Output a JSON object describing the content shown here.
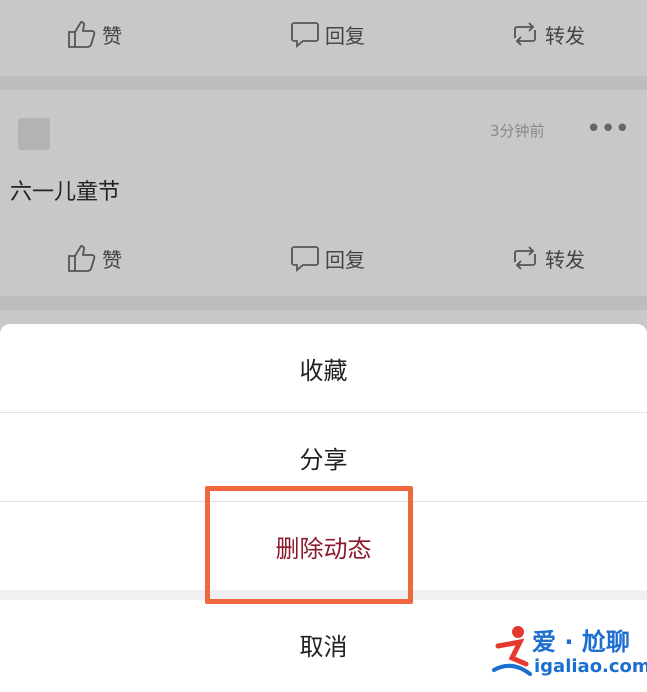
{
  "feed": {
    "top_actions": {
      "like": "赞",
      "reply": "回复",
      "forward": "转发"
    },
    "post": {
      "username": "· ·",
      "timestamp": "3分钟前",
      "more": "•••",
      "text": "六一儿童节",
      "actions": {
        "like": "赞",
        "reply": "回复",
        "forward": "转发"
      }
    }
  },
  "sheet": {
    "items": [
      {
        "label": "收藏"
      },
      {
        "label": "分享"
      },
      {
        "label": "删除动态"
      },
      {
        "label": "取消"
      }
    ],
    "delete_color": "#8b1a2b",
    "highlight_color": "#f0673d"
  },
  "watermark": {
    "title": "爱 · 尬聊",
    "url": "igaliao.com"
  }
}
